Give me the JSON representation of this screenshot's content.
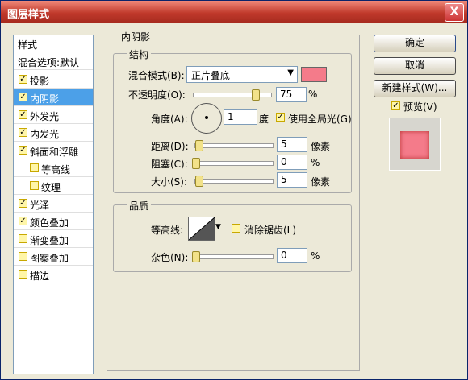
{
  "window": {
    "title": "图层样式",
    "close_label": "X"
  },
  "style_list": {
    "header": "样式",
    "blend_options": "混合选项:默认",
    "items": [
      {
        "label": "投影",
        "checked": true
      },
      {
        "label": "内阴影",
        "checked": true
      },
      {
        "label": "外发光",
        "checked": true
      },
      {
        "label": "内发光",
        "checked": true
      },
      {
        "label": "斜面和浮雕",
        "checked": true
      },
      {
        "label": "等高线",
        "checked": false
      },
      {
        "label": "纹理",
        "checked": false
      },
      {
        "label": "光泽",
        "checked": true
      },
      {
        "label": "颜色叠加",
        "checked": true
      },
      {
        "label": "渐变叠加",
        "checked": false
      },
      {
        "label": "图案叠加",
        "checked": false
      },
      {
        "label": "描边",
        "checked": false
      }
    ]
  },
  "inner_shadow": {
    "title": "内阴影",
    "structure": {
      "title": "结构",
      "blend_mode_label": "混合模式(B):",
      "blend_mode_value": "正片叠底",
      "blend_color": "#f47b8a",
      "opacity_label": "不透明度(O):",
      "opacity_value": "75",
      "opacity_unit": "%",
      "angle_label": "角度(A):",
      "angle_value": "1",
      "angle_unit": "度",
      "global_light_label": "使用全局光(G)",
      "distance_label": "距离(D):",
      "distance_value": "5",
      "distance_unit": "像素",
      "choke_label": "阻塞(C):",
      "choke_value": "0",
      "choke_unit": "%",
      "size_label": "大小(S):",
      "size_value": "5",
      "size_unit": "像素"
    },
    "quality": {
      "title": "品质",
      "contour_label": "等高线:",
      "anti_alias_label": "消除锯齿(L)",
      "noise_label": "杂色(N):",
      "noise_value": "0",
      "noise_unit": "%"
    }
  },
  "buttons": {
    "ok": "确定",
    "cancel": "取消",
    "new_style": "新建样式(W)...",
    "preview_label": "预览(V)"
  }
}
